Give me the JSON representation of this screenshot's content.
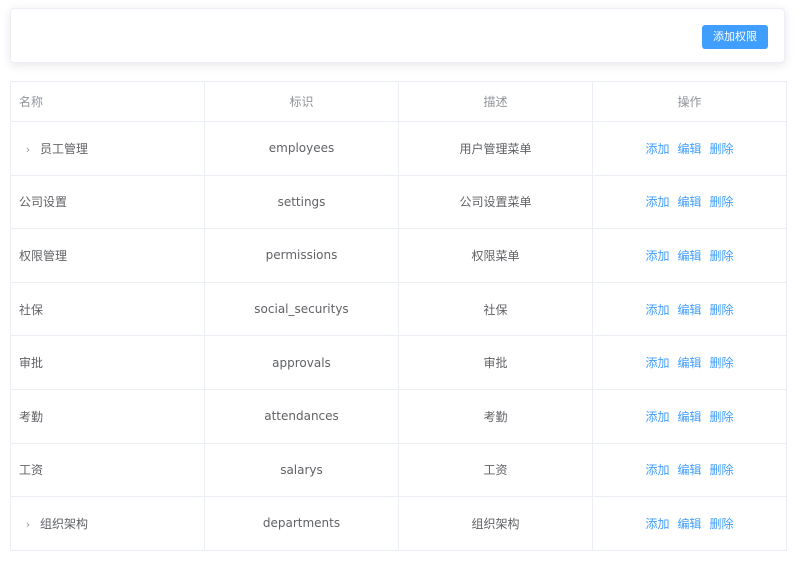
{
  "toolbar": {
    "add_permission_label": "添加权限"
  },
  "table": {
    "headers": {
      "name": "名称",
      "code": "标识",
      "description": "描述",
      "operations": "操作"
    },
    "ops": {
      "add": "添加",
      "edit": "编辑",
      "delete": "删除"
    },
    "rows": [
      {
        "name": "员工管理",
        "code": "employees",
        "description": "用户管理菜单",
        "expandable": true
      },
      {
        "name": "公司设置",
        "code": "settings",
        "description": "公司设置菜单",
        "expandable": false
      },
      {
        "name": "权限管理",
        "code": "permissions",
        "description": "权限菜单",
        "expandable": false
      },
      {
        "name": "社保",
        "code": "social_securitys",
        "description": "社保",
        "expandable": false
      },
      {
        "name": "审批",
        "code": "approvals",
        "description": "审批",
        "expandable": false
      },
      {
        "name": "考勤",
        "code": "attendances",
        "description": "考勤",
        "expandable": false
      },
      {
        "name": "工资",
        "code": "salarys",
        "description": "工资",
        "expandable": false
      },
      {
        "name": "组织架构",
        "code": "departments",
        "description": "组织架构",
        "expandable": true
      }
    ]
  },
  "icons": {
    "expand": "chevron-right-icon"
  },
  "colors": {
    "primary": "#409eff",
    "border": "#ebeef5",
    "header_text": "#909399",
    "body_text": "#606266"
  }
}
